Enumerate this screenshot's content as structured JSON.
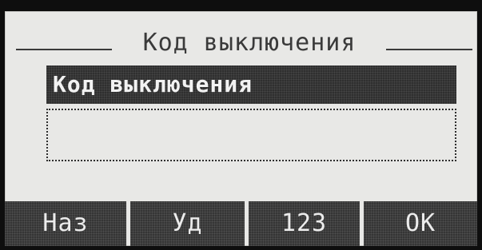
{
  "screen": {
    "title": "Код выключения",
    "field": {
      "label": "Код выключения",
      "value": ""
    }
  },
  "softkeys": [
    {
      "label": "Наз"
    },
    {
      "label": "Уд"
    },
    {
      "label": "123"
    },
    {
      "label": "ОК"
    }
  ],
  "colors": {
    "lcd_background": "#e8e8e6",
    "lcd_dark": "#2f2f2f",
    "lcd_text_light": "#f2f2f2",
    "bezel": "#0e0e0e"
  }
}
